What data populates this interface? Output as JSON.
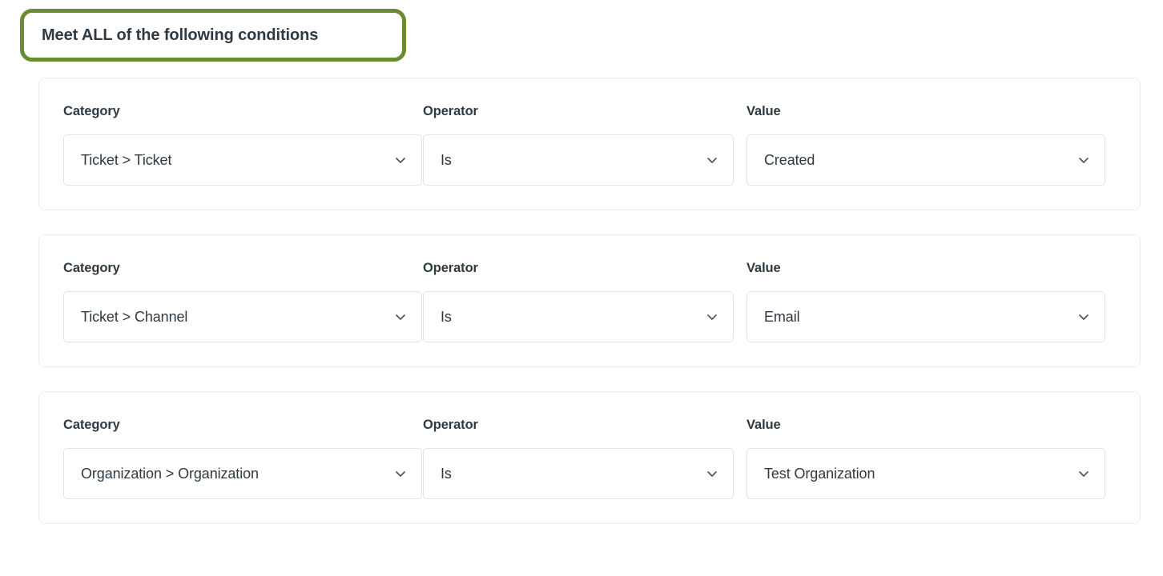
{
  "heading": {
    "text": "Meet ALL of the following conditions",
    "annotation_color": "#688c2f",
    "text_color": "#2f3941"
  },
  "labels": {
    "category": "Category",
    "operator": "Operator",
    "value": "Value"
  },
  "icons": {
    "chevron": "chevron-down-icon"
  },
  "conditions": [
    {
      "category": "Ticket > Ticket",
      "operator": "Is",
      "value": "Created"
    },
    {
      "category": "Ticket > Channel",
      "operator": "Is",
      "value": "Email"
    },
    {
      "category": "Organization > Organization",
      "operator": "Is",
      "value": "Test Organization"
    }
  ]
}
